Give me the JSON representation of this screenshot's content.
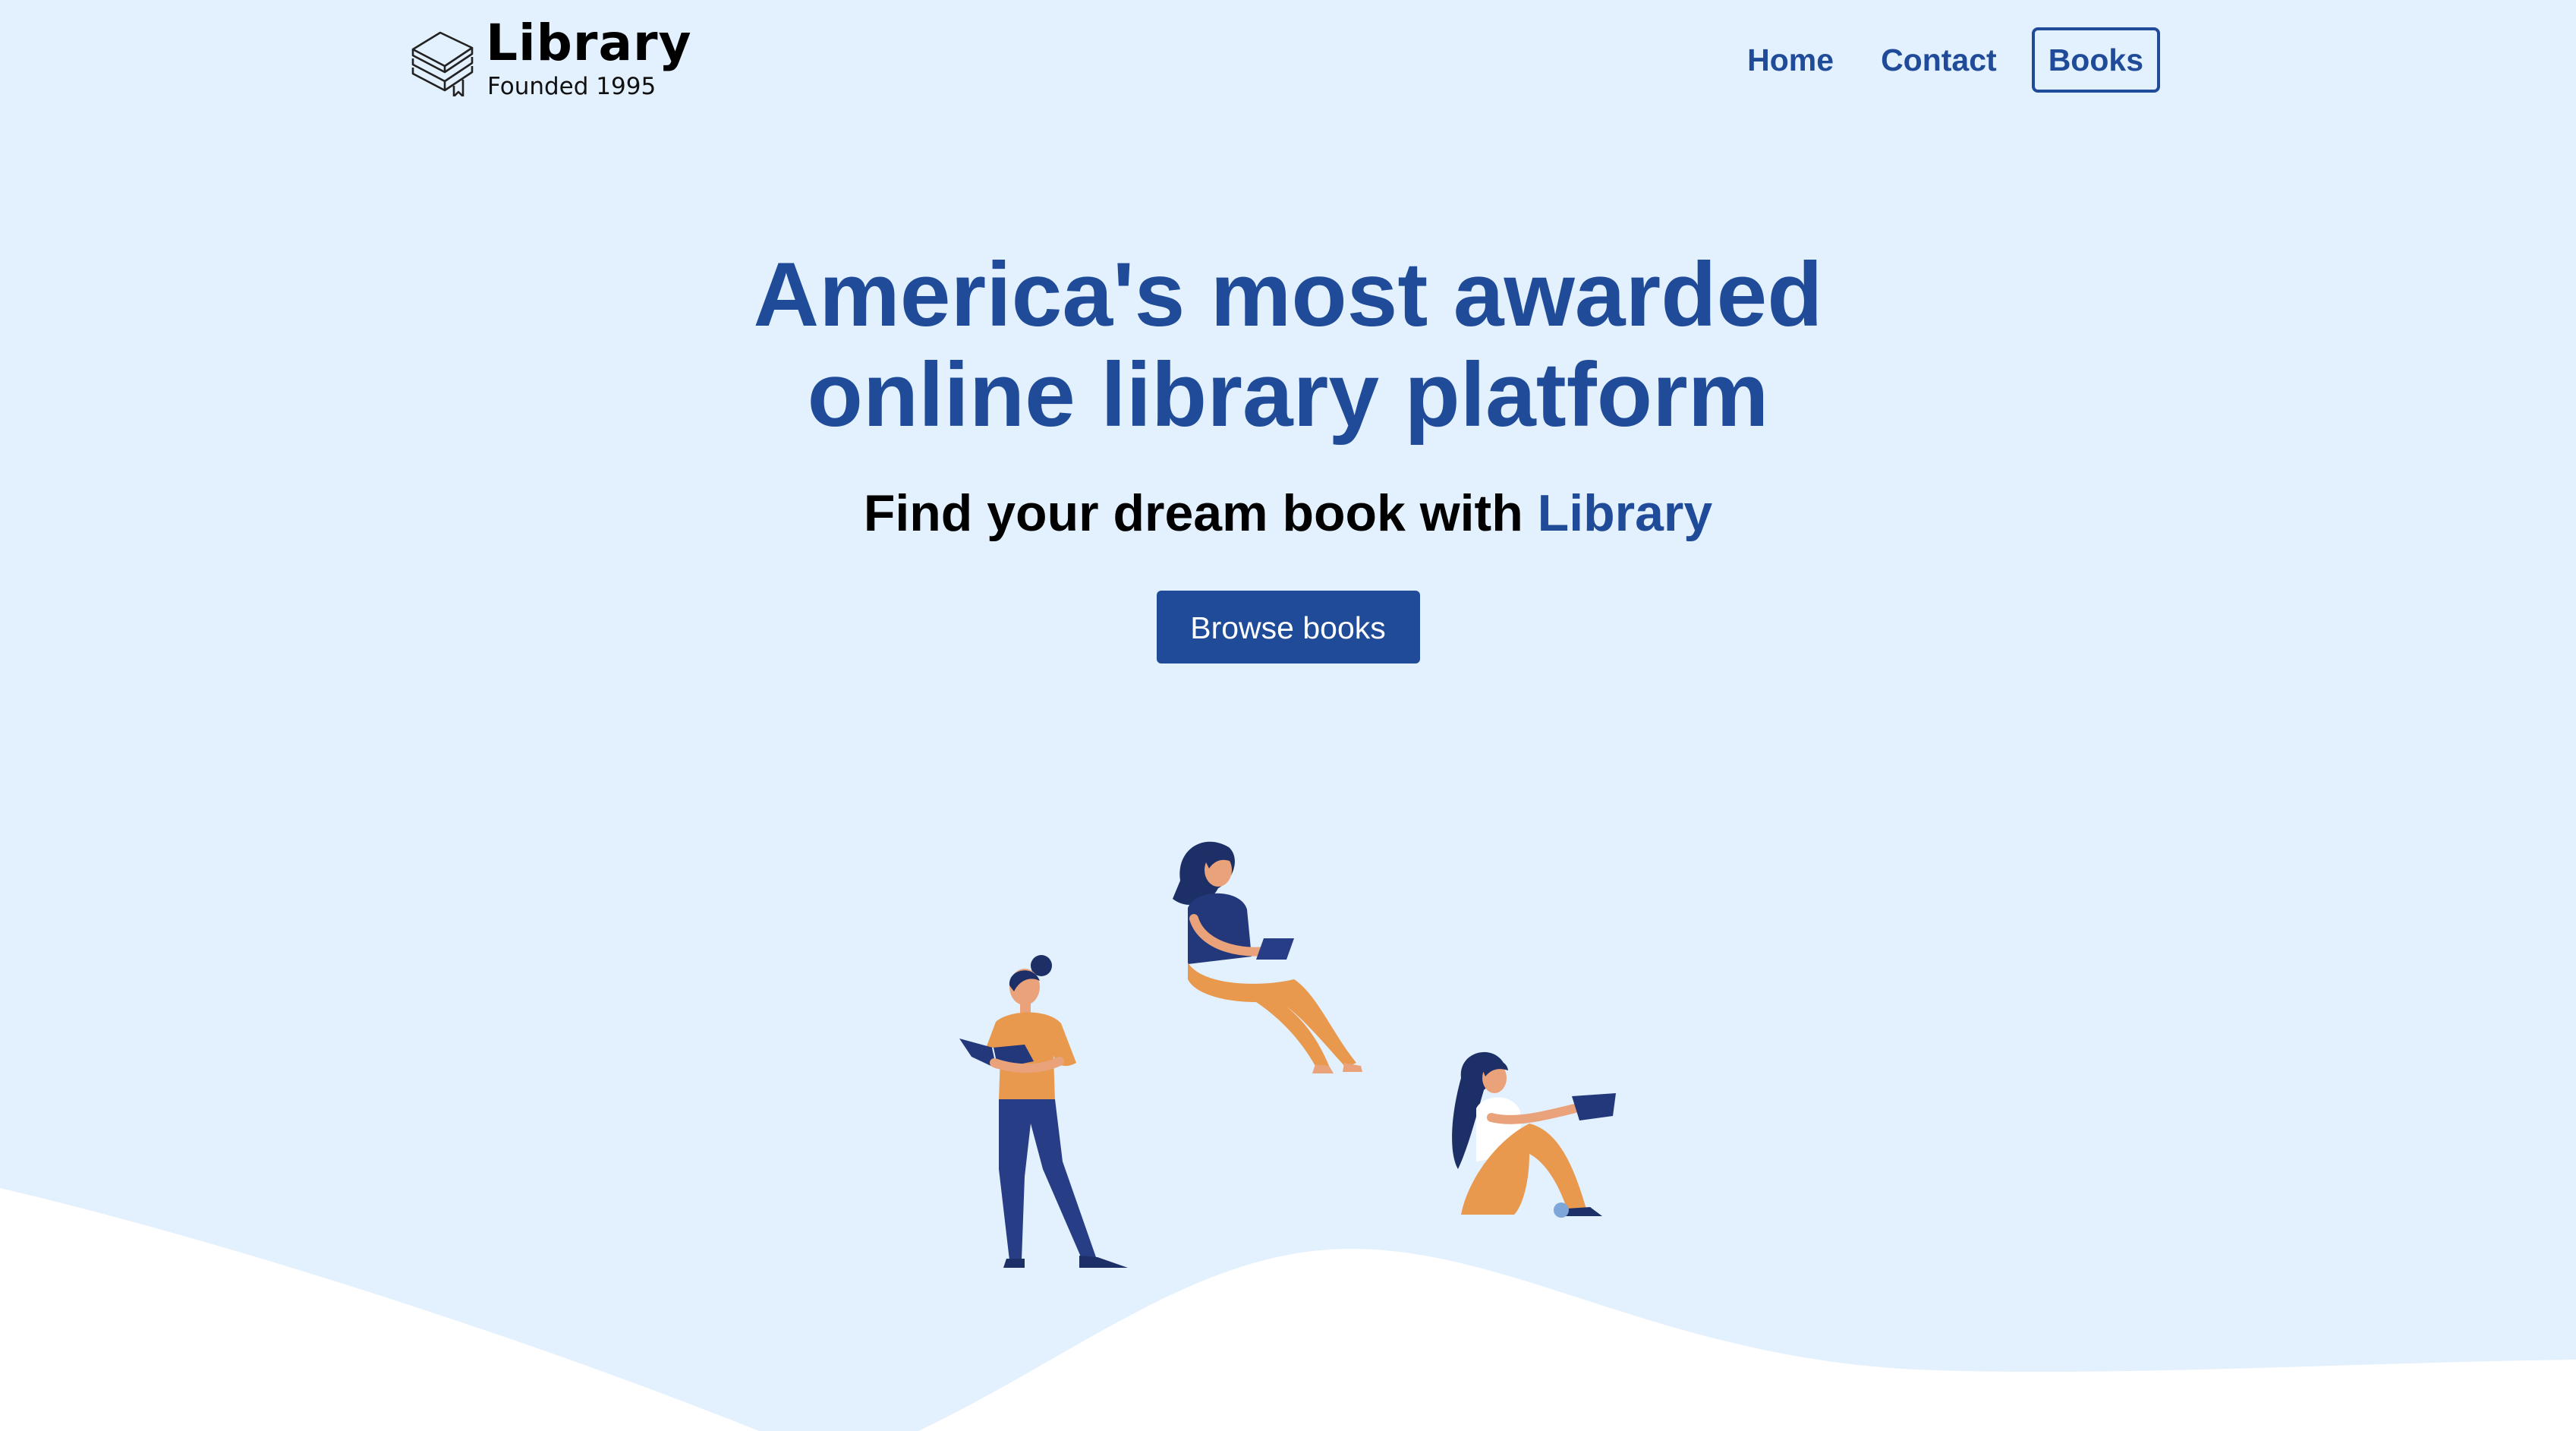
{
  "header": {
    "logo_title": "Library",
    "logo_subtitle": "Founded 1995"
  },
  "nav": {
    "items": [
      {
        "label": "Home",
        "active": false
      },
      {
        "label": "Contact",
        "active": false
      },
      {
        "label": "Books",
        "active": true
      }
    ]
  },
  "hero": {
    "title_line1": "America's most awarded",
    "title_line2": "online library platform",
    "subtitle_prefix": "Find your dream book with",
    "subtitle_brand": "Library",
    "cta_label": "Browse books"
  },
  "icons": {
    "logo": "stacked-books-icon"
  },
  "colors": {
    "background": "#e3f0fd",
    "accent": "#1f4b99",
    "wave": "#ffffff",
    "figure_orange": "#e8994e",
    "figure_navy": "#22387a"
  }
}
